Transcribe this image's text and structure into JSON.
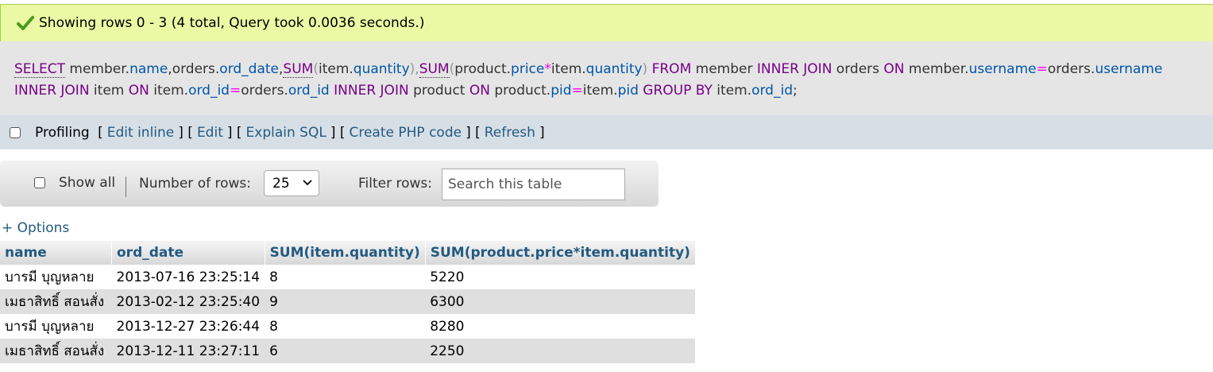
{
  "status": {
    "message": "Showing rows 0 - 3 (4 total, Query took 0.0036 seconds.)",
    "color": "#ebf8a4"
  },
  "sql": {
    "tokens": [
      {
        "t": "SELECT",
        "c": "fn-kw"
      },
      {
        "t": " member.",
        "c": "plain"
      },
      {
        "t": "name",
        "c": "var"
      },
      {
        "t": ",orders.",
        "c": "plain"
      },
      {
        "t": "ord_date",
        "c": "var"
      },
      {
        "t": ",",
        "c": "plain"
      },
      {
        "t": "SUM",
        "c": "fn"
      },
      {
        "t": "(",
        "c": "br"
      },
      {
        "t": "item.",
        "c": "plain"
      },
      {
        "t": "quantity",
        "c": "var"
      },
      {
        "t": "),",
        "c": "br"
      },
      {
        "t": "SUM",
        "c": "fn"
      },
      {
        "t": "(",
        "c": "br"
      },
      {
        "t": "product.",
        "c": "plain"
      },
      {
        "t": "price",
        "c": "var"
      },
      {
        "t": "*",
        "c": "op"
      },
      {
        "t": "item.",
        "c": "plain"
      },
      {
        "t": "quantity",
        "c": "var"
      },
      {
        "t": ") ",
        "c": "br"
      },
      {
        "t": "FROM",
        "c": "kw"
      },
      {
        "t": " member ",
        "c": "plain"
      },
      {
        "t": "INNER JOIN",
        "c": "kw"
      },
      {
        "t": " orders ",
        "c": "plain"
      },
      {
        "t": "ON",
        "c": "kw"
      },
      {
        "t": " member.",
        "c": "plain"
      },
      {
        "t": "username",
        "c": "var"
      },
      {
        "t": "=",
        "c": "op"
      },
      {
        "t": "orders.",
        "c": "plain"
      },
      {
        "t": "username",
        "c": "var"
      },
      {
        "t": " ",
        "c": "plain"
      },
      {
        "t": "INNER JOIN",
        "c": "kw"
      },
      {
        "t": " item ",
        "c": "plain"
      },
      {
        "t": "ON",
        "c": "kw"
      },
      {
        "t": " item.",
        "c": "plain"
      },
      {
        "t": "ord_id",
        "c": "var"
      },
      {
        "t": "=",
        "c": "op"
      },
      {
        "t": "orders.",
        "c": "plain"
      },
      {
        "t": "ord_id",
        "c": "var"
      },
      {
        "t": " ",
        "c": "plain"
      },
      {
        "t": "INNER JOIN",
        "c": "kw"
      },
      {
        "t": " product ",
        "c": "plain"
      },
      {
        "t": "ON",
        "c": "kw"
      },
      {
        "t": " product.",
        "c": "plain"
      },
      {
        "t": "pid",
        "c": "var"
      },
      {
        "t": "=",
        "c": "op"
      },
      {
        "t": "item.",
        "c": "plain"
      },
      {
        "t": "pid",
        "c": "var"
      },
      {
        "t": " ",
        "c": "plain"
      },
      {
        "t": "GROUP BY",
        "c": "kw"
      },
      {
        "t": " item.",
        "c": "plain"
      },
      {
        "t": "ord_id",
        "c": "var"
      },
      {
        "t": ";",
        "c": "plain"
      }
    ]
  },
  "profiling": {
    "label": "Profiling",
    "links": [
      "Edit inline",
      "Edit",
      "Explain SQL",
      "Create PHP code",
      "Refresh"
    ]
  },
  "nav": {
    "show_all": "Show all",
    "num_rows_label": "Number of rows:",
    "num_rows_value": "25",
    "filter_label": "Filter rows:",
    "search_placeholder": "Search this table"
  },
  "options_label": "+ Options",
  "table": {
    "headers": [
      "name",
      "ord_date",
      "SUM(item.quantity)",
      "SUM(product.price*item.quantity)"
    ],
    "rows": [
      [
        "บารมี บุญหลาย",
        "2013-07-16 23:25:14",
        "8",
        "5220"
      ],
      [
        "เมธาสิทธิ์ สอนสั่ง",
        "2013-02-12 23:25:40",
        "9",
        "6300"
      ],
      [
        "บารมี บุญหลาย",
        "2013-12-27 23:26:44",
        "8",
        "8280"
      ],
      [
        "เมธาสิทธิ์ สอนสั่ง",
        "2013-12-11 23:27:11",
        "6",
        "2250"
      ]
    ]
  }
}
